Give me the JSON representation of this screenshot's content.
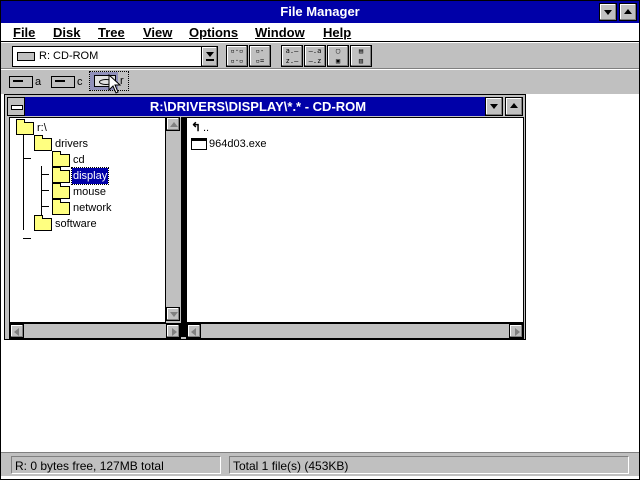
{
  "app": {
    "title": "File Manager"
  },
  "menu": [
    "File",
    "Disk",
    "Tree",
    "View",
    "Options",
    "Window",
    "Help"
  ],
  "toolbar": {
    "drive_select_value": "R: CD-ROM",
    "buttons": [
      {
        "name": "connect-network-drive-icon"
      },
      {
        "name": "disconnect-network-drive-icon"
      },
      {
        "name": "sort-by-name-icon"
      },
      {
        "name": "sort-by-type-icon"
      },
      {
        "name": "copy-disk-icon"
      },
      {
        "name": "properties-icon"
      }
    ]
  },
  "drive_bar": [
    {
      "letter": "a",
      "icon": "floppy-drive-icon"
    },
    {
      "letter": "c",
      "icon": "hard-drive-icon"
    },
    {
      "letter": "r",
      "icon": "cdrom-drive-icon",
      "selected": true
    }
  ],
  "dir_window": {
    "title": "R:\\DRIVERS\\DISPLAY\\*.* - CD-ROM",
    "tree": [
      {
        "label": "r:\\",
        "level": 0
      },
      {
        "label": "drivers",
        "level": 1
      },
      {
        "label": "cd",
        "level": 2
      },
      {
        "label": "display",
        "level": 2,
        "selected": true
      },
      {
        "label": "mouse",
        "level": 2
      },
      {
        "label": "network",
        "level": 2
      },
      {
        "label": "software",
        "level": 1
      }
    ],
    "files": [
      {
        "label": "..",
        "icon": "parent-directory-icon"
      },
      {
        "label": "964d03.exe",
        "icon": "executable-icon"
      }
    ]
  },
  "status": {
    "left": "R: 0 bytes free, 127MB total",
    "right": "Total 1 file(s) (453KB)"
  },
  "colors": {
    "title_bar": "#0000a8",
    "face": "#c0c0c0",
    "folder": "#ffff80",
    "selection": "#0000a8"
  }
}
